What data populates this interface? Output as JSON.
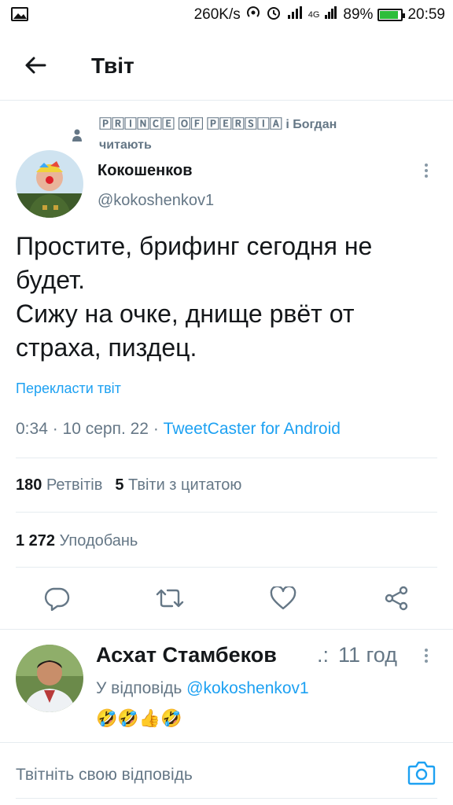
{
  "status_bar": {
    "speed": "260K/s",
    "network": "4G",
    "battery": "89%",
    "battery_level": 0.89,
    "time": "20:59"
  },
  "header": {
    "title": "Твіт",
    "back_icon": "arrow-left-icon"
  },
  "social_context": {
    "names": "🄿🅁🄸🄽🄲🄴 🄾🄵 🄿🄴🅁🅂🄸🄰 і Богдан",
    "verb": "читають",
    "icon": "person-icon"
  },
  "tweet": {
    "author_name": "Кокошенков",
    "author_handle": "@kokoshenkov1",
    "text_lines": [
      "Простите, брифинг сегодня не",
      "будет.",
      "Сижу на очке, днище рвёт от",
      "страха, пиздец."
    ],
    "translate_label": "Перекласти твіт",
    "timestamp": "0:34 · 10 серп. 22 · ",
    "source": "TweetCaster for Android",
    "retweets_count": "180",
    "retweets_label": "Ретвітів",
    "quotes_count": "5",
    "quotes_label": "Твіти з цитатою",
    "likes_count": "1 272",
    "likes_label": "Уподобань"
  },
  "actions": [
    {
      "icon": "reply-icon"
    },
    {
      "icon": "retweet-icon"
    },
    {
      "icon": "like-icon"
    },
    {
      "icon": "share-icon"
    }
  ],
  "reply": {
    "author_name": "Асхат Стамбеков",
    "ellipsis": ".:",
    "time": "11 год",
    "reply_to_label": "У відповідь ",
    "reply_to_handle": "@kokoshenkov1",
    "text": "🤣🤣👍🤣"
  },
  "compose": {
    "placeholder": "Твітніть свою відповідь",
    "camera_icon": "camera-icon"
  },
  "colors": {
    "accent": "#1da1f2",
    "secondary_text": "#657786",
    "primary_text": "#14171a",
    "divider": "#e6ecf0",
    "battery_green": "#2dbd3a"
  }
}
